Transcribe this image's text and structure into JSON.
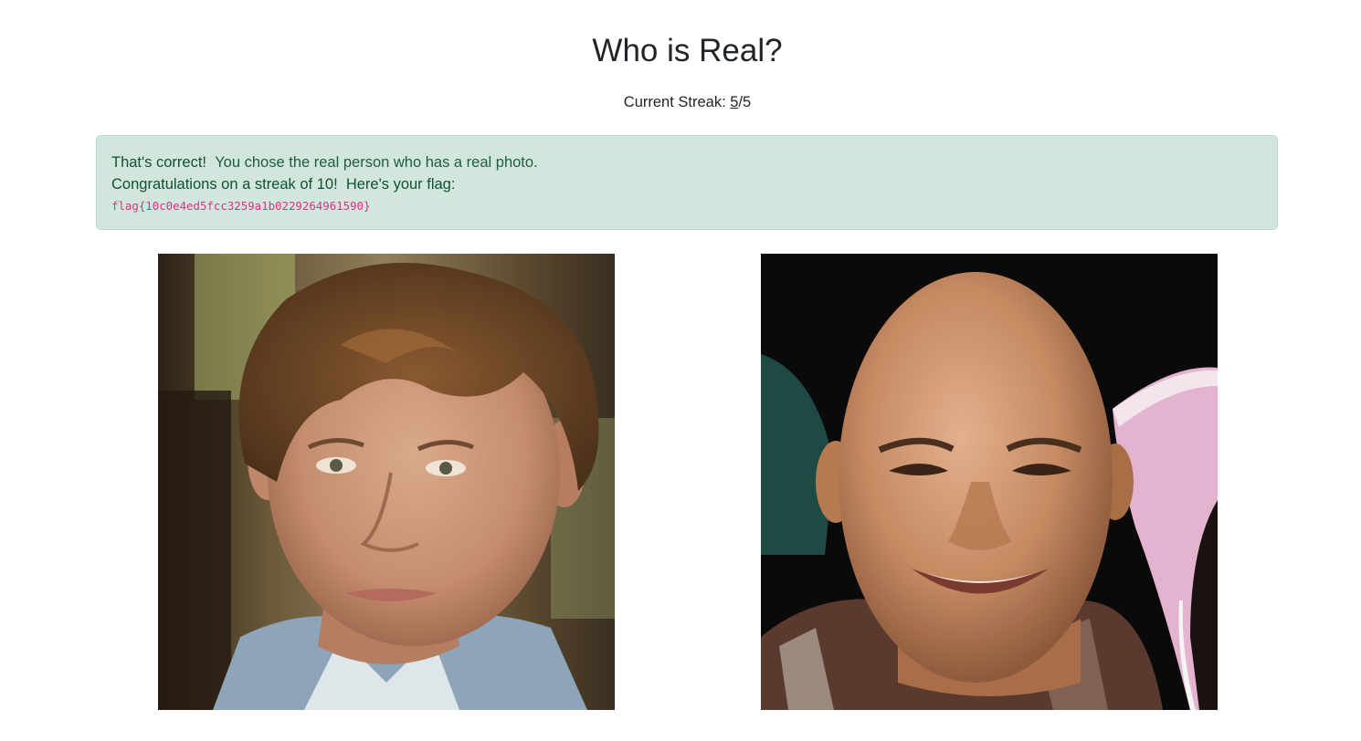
{
  "header": {
    "title": "Who is Real?",
    "streak_label": "Current Streak:",
    "streak_current": "5",
    "streak_separator": "/",
    "streak_total": "5"
  },
  "alert": {
    "correct_strong": "That's correct!",
    "correct_text": "You chose the real person who has a real photo.",
    "congrats_text": "Congratulations on a streak of 10!",
    "flag_intro": "Here's your flag:",
    "flag": "flag{10c0e4ed5fcc3259a1b0229264961590}",
    "colors": {
      "background": "#d1e7dd",
      "border": "#badbcc",
      "text": "#0f5132",
      "flag": "#d63384"
    }
  },
  "photos": [
    {
      "name": "photo-left",
      "description_icon": "face-photo-icon"
    },
    {
      "name": "photo-right",
      "description_icon": "face-photo-icon"
    }
  ]
}
